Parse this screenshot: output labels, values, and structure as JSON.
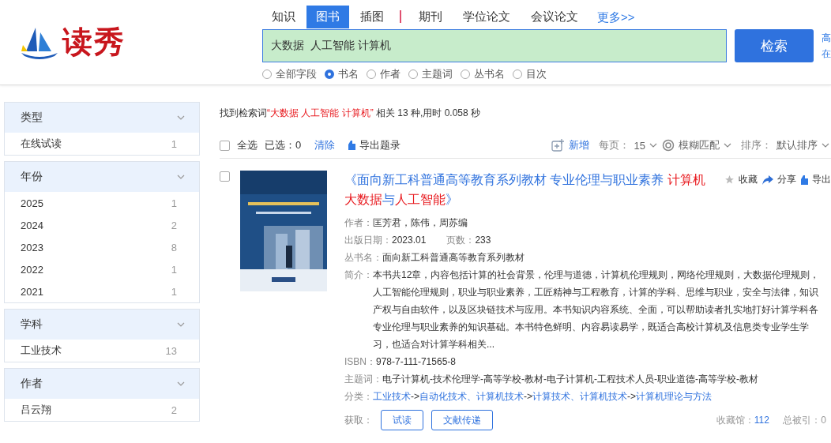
{
  "header": {
    "logo": "读秀",
    "tabs": [
      {
        "label": "知识",
        "selected": false
      },
      {
        "label": "图书",
        "selected": true
      },
      {
        "label": "插图",
        "selected": false
      },
      {
        "label": "期刊",
        "selected": false
      },
      {
        "label": "学位论文",
        "selected": false
      },
      {
        "label": "会议论文",
        "selected": false
      }
    ],
    "more_link": "更多>>",
    "search": {
      "value": "大数据  人工智能 计算机"
    },
    "search_button": "检索",
    "side_links": [
      "高",
      "在"
    ],
    "fields": [
      {
        "label": "全部字段",
        "selected": false
      },
      {
        "label": "书名",
        "selected": true
      },
      {
        "label": "作者",
        "selected": false
      },
      {
        "label": "主题词",
        "selected": false
      },
      {
        "label": "丛书名",
        "selected": false
      },
      {
        "label": "目次",
        "selected": false
      }
    ]
  },
  "sidebar": [
    {
      "title": "类型",
      "items": [
        {
          "label": "在线试读",
          "count": "1"
        }
      ]
    },
    {
      "title": "年份",
      "items": [
        {
          "label": "2025",
          "count": "1"
        },
        {
          "label": "2024",
          "count": "2"
        },
        {
          "label": "2023",
          "count": "8"
        },
        {
          "label": "2022",
          "count": "1"
        },
        {
          "label": "2021",
          "count": "1"
        }
      ]
    },
    {
      "title": "学科",
      "items": [
        {
          "label": "工业技术",
          "count": "13"
        }
      ]
    },
    {
      "title": "作者",
      "items": [
        {
          "label": "吕云翔",
          "count": "2"
        }
      ]
    }
  ],
  "summary": {
    "prefix": "找到检索词",
    "query": "“大数据 人工智能 计算机”",
    "suffix": "相关 13 种,用时 0.058 秒"
  },
  "toolbar": {
    "select_all": {
      "label": "全选",
      "checked": false
    },
    "selected_count": "已选：0",
    "clear": "清除",
    "export": "导出题录",
    "add": "新增",
    "per_page_label": "每页：",
    "per_page": "15",
    "match": "模糊匹配",
    "sort_label": "排序：",
    "sort": "默认排序"
  },
  "results": [
    {
      "checked": false,
      "cover": {
        "kind": "picture"
      },
      "title": [
        {
          "text": "《面向新工科普通高等教育系列教材 专业伦理与职业素养 ",
          "highlight": false
        },
        {
          "text": "计算机",
          "highlight": true
        },
        {
          "text": "大数据",
          "highlight": true
        },
        {
          "text": "与",
          "highlight": false
        },
        {
          "text": "人工智能",
          "highlight": true
        },
        {
          "text": "》",
          "highlight": false
        }
      ],
      "actions": [
        "收藏",
        "分享",
        "导出"
      ],
      "author_label": "作者：",
      "author": "匡芳君，陈伟，周苏编",
      "date_label": "出版日期：",
      "date": "2023.01",
      "pages_label": "页数：",
      "pages": "233",
      "series_label": "丛书名：",
      "series": "面向新工科普通高等教育系列教材",
      "abstract_label": "简介：",
      "abstract": "本书共12章，内容包括计算的社会背景，伦理与道德，计算机伦理规则，网络伦理规则，大数据伦理规则，人工智能伦理规则，职业与职业素养，工匠精神与工程教育，计算的学科、思维与职业，安全与法律，知识产权与自由软件，以及区块链技术与应用。本书知识内容系统、全面，可以帮助读者扎实地打好计算学科各专业伦理与职业素养的知识基础。本书特色鲜明、内容易读易学，既适合高校计算机及信息类专业学生学习，也适合对计算学科相关...",
      "isbn_label": "ISBN：",
      "isbn": "978-7-111-71565-8",
      "subject_label": "主题词：",
      "subject": "电子计算机-技术伦理学-高等学校-教材-电子计算机-工程技术人员-职业道德-高等学校-教材",
      "class_label": "分类：",
      "classes": [
        "工业技术",
        "自动化技术、计算机技术",
        "计算技术、计算机技术",
        "计算机理论与方法"
      ],
      "class_sep": "->",
      "get_label": "获取：",
      "get_buttons": [
        "试读",
        "文献传递"
      ],
      "collect_label": "收藏馆：",
      "collect": "112",
      "cited_label": "总被引：",
      "cited": "0"
    }
  ]
}
